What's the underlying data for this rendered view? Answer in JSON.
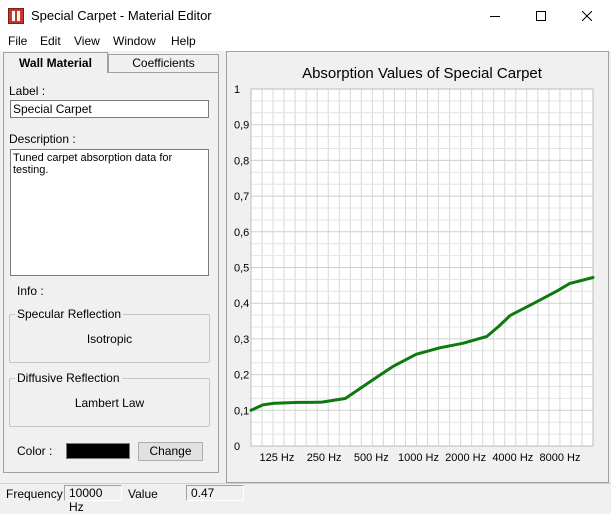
{
  "window": {
    "title": "Special Carpet - Material Editor",
    "icon": "app-logo-icon",
    "controls": [
      "minimize-icon",
      "maximize-icon",
      "close-icon"
    ]
  },
  "menu": [
    "File",
    "Edit",
    "View",
    "Window",
    "Help"
  ],
  "tabs": {
    "wall_material": "Wall Material",
    "coefficients": "Coefficients"
  },
  "form": {
    "label_caption": "Label :",
    "label_value": "Special Carpet",
    "description_caption": "Description :",
    "description_value": "Tuned carpet absorption data for testing.",
    "info_caption": "Info :",
    "specular_title": "Specular Reflection",
    "specular_value": "Isotropic",
    "diffusive_title": "Diffusive Reflection",
    "diffusive_value": "Lambert Law",
    "color_caption": "Color :",
    "color_value": "#000000",
    "change_button": "Change"
  },
  "chart_data": {
    "type": "line",
    "title": "Absorption Values of Special Carpet",
    "xlabel": "",
    "ylabel": "",
    "ylim": [
      0,
      1
    ],
    "y_ticks": [
      "0",
      "0,1",
      "0,2",
      "0,3",
      "0,4",
      "0,5",
      "0,6",
      "0,7",
      "0,8",
      "0,9",
      "1"
    ],
    "x_ticks": [
      "125 Hz",
      "250 Hz",
      "500 Hz",
      "1000 Hz",
      "2000 Hz",
      "4000 Hz",
      "8000 Hz"
    ],
    "grid": true,
    "line_color": "#0e7a0e",
    "series": [
      {
        "name": "",
        "x_octave_pos": [
          0,
          0.25,
          0.5,
          1.0,
          1.25,
          1.5,
          2.0,
          2.5,
          3.0,
          3.5,
          4.0,
          4.5,
          5.0,
          5.25,
          5.5,
          6.0,
          6.5,
          6.75,
          7.25
        ],
        "values": [
          0.1,
          0.115,
          0.12,
          0.122,
          0.122,
          0.123,
          0.133,
          0.178,
          0.222,
          0.257,
          0.275,
          0.288,
          0.307,
          0.335,
          0.366,
          0.4,
          0.435,
          0.455,
          0.472
        ]
      }
    ]
  },
  "status": {
    "frequency_label": "Frequency",
    "frequency_value": "10000 Hz",
    "value_label": "Value",
    "value_value": "0.47"
  }
}
